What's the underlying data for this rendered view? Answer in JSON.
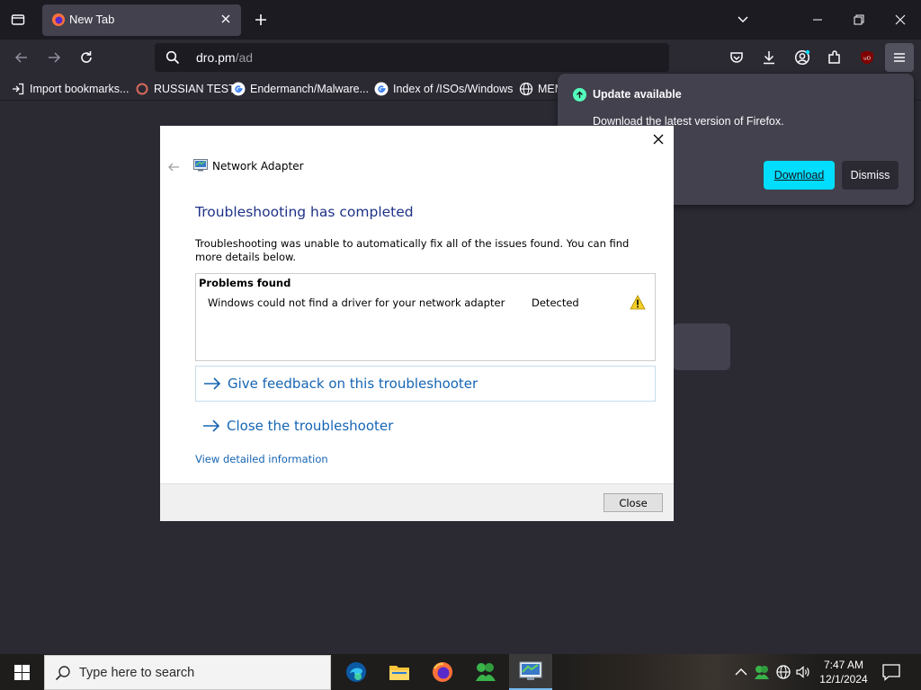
{
  "browser": {
    "tab": {
      "title": "New Tab"
    },
    "url": {
      "host": "dro.pm",
      "path": "/ad"
    },
    "bookmarks": [
      {
        "label": "Import bookmarks...",
        "icon": "import-icon"
      },
      {
        "label": "RUSSIAN TEST",
        "icon": "site-icon"
      },
      {
        "label": "Endermanch/Malware...",
        "icon": "google-icon"
      },
      {
        "label": "Index of /ISOs/Windows",
        "icon": "google-icon"
      },
      {
        "label": "MEM",
        "icon": "globe-icon"
      }
    ],
    "toolbar_icons": [
      "pocket-icon",
      "download-icon",
      "account-icon",
      "extensions-icon",
      "ublock-icon",
      "menu-icon"
    ]
  },
  "update_popup": {
    "title": "Update available",
    "message": "Download the latest version of Firefox.",
    "download_label": "Download",
    "dismiss_label": "Dismiss"
  },
  "dialog": {
    "app_title": "Network Adapter",
    "heading": "Troubleshooting has completed",
    "description": "Troubleshooting was unable to automatically fix all of the issues found. You can find more details below.",
    "problems": {
      "header": "Problems found",
      "items": [
        {
          "text": "Windows could not find a driver for your network adapter",
          "status": "Detected"
        }
      ]
    },
    "feedback_link": "Give feedback on this troubleshooter",
    "close_link": "Close the troubleshooter",
    "details_link": "View detailed information",
    "close_button": "Close"
  },
  "taskbar": {
    "search_placeholder": "Type here to search",
    "apps": [
      "edge-icon",
      "file-explorer-icon",
      "firefox-icon",
      "xbox-like-icon",
      "network-troubleshooter-icon"
    ],
    "time": "7:47 AM",
    "date": "12/1/2024"
  },
  "colors": {
    "accent_download": "#00ddff",
    "heading_blue": "#1e3287",
    "link_blue": "#1665b4"
  }
}
